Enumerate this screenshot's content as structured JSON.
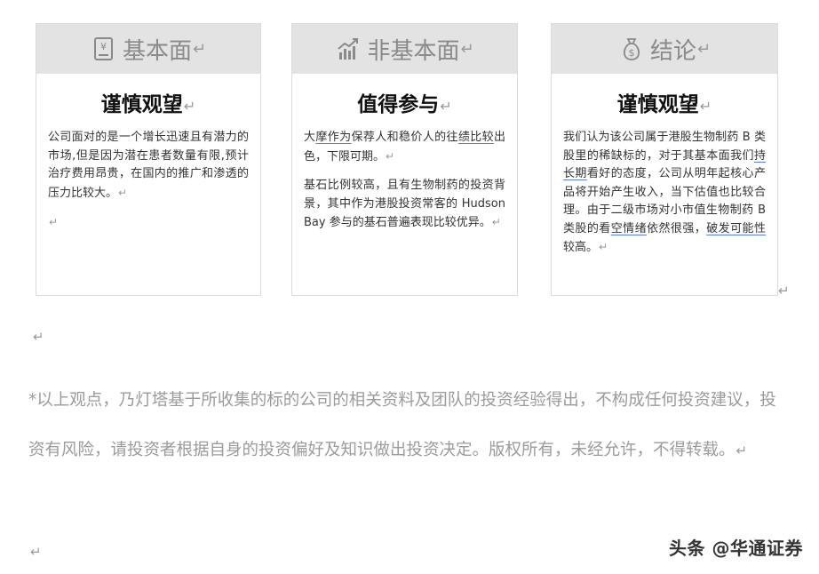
{
  "return_mark": "↵",
  "cards": [
    {
      "header": "基本面",
      "icon": "yuan-book-icon",
      "title": "谨慎观望",
      "paragraphs": [
        "公司面对的是一个增长迅速且有潜力的市场,但是因为潜在患者数量有限,预计治疗费用昂贵，在国内的推广和渗透的压力比较大。"
      ]
    },
    {
      "header": "非基本面",
      "icon": "trend-chart-icon",
      "title": "值得参与",
      "p1_a": "大",
      "p1_u1": "摩作为",
      "p1_b": "保荐人和稳价人的往",
      "p1_u2": "绩比较",
      "p1_c": "出色，下限可期。",
      "p2": "基石比例较高，且有生物制药的投资背景，其中作为港股投资常客的 Hudson Bay 参与的基石普遍表现比较优异。"
    },
    {
      "header": "结论",
      "icon": "money-bag-icon",
      "title": "谨慎观望",
      "p_a": "我们认为该公司属于港股生物制药 B 类股里的稀缺标的，对于其基本面我们",
      "p_u1": "持长期",
      "p_b": "看好的态度，公司从明年起核心产品将开始产生收入，当下估值也比较合理。由于二级市场对小市值生物制药 B 类股的看",
      "p_u2": "空情绪",
      "p_c": "依然很强，",
      "p_u3": "破发可能性",
      "p_d": "较高。"
    }
  ],
  "disclaimer": "*以上观点，乃灯塔基于所收集的标的公司的相关资料及团队的投资经验得出，不构成任何投资建议，投资有风险，请投资者根据自身的投资偏好及知识做出投资决定。版权所有，未经允许，不得转载。",
  "watermark": "头条 @华通证券"
}
